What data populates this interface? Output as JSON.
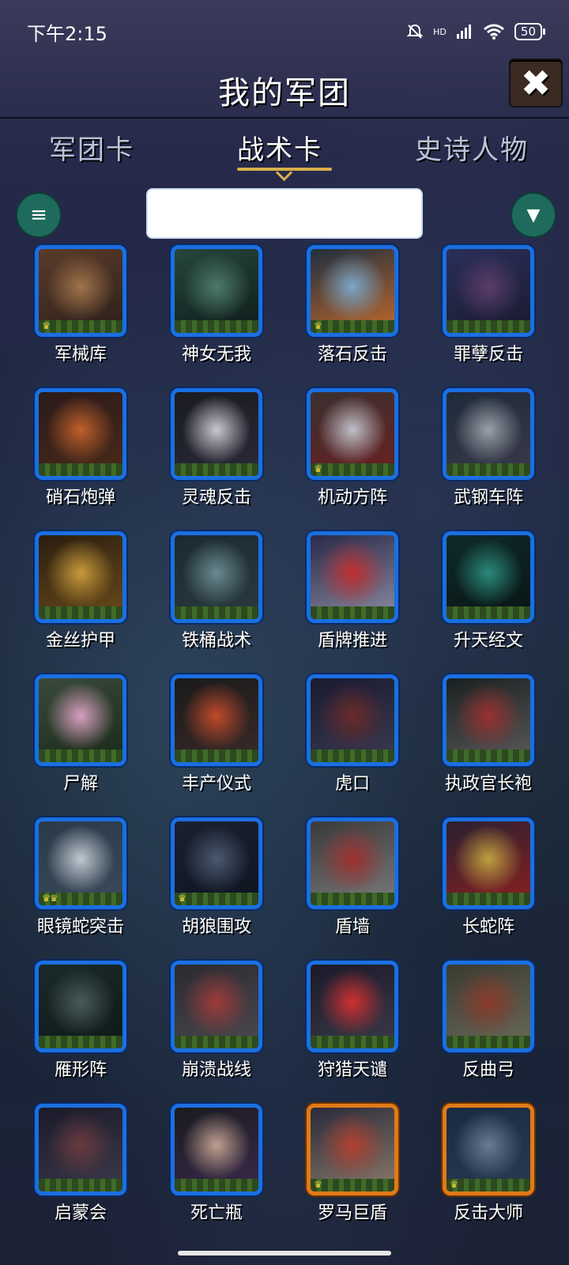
{
  "status_bar": {
    "time": "下午2:15",
    "icons": [
      "bell-off-icon",
      "signal-icon",
      "wifi-icon"
    ],
    "hd_label": "HD",
    "battery": "50"
  },
  "header": {
    "title": "我的军团",
    "close_label": "✖"
  },
  "tabs": [
    {
      "label": "军团卡",
      "active": false
    },
    {
      "label": "战术卡",
      "active": true
    },
    {
      "label": "史诗人物",
      "active": false
    }
  ],
  "toolbar": {
    "list_icon": "≡",
    "filter_icon": "▼",
    "search_value": ""
  },
  "cards": [
    {
      "name": "军械库",
      "crowns": 1,
      "rarity": "blue",
      "art": [
        "#5a3b2a",
        "#a0744c",
        "#2c1f1a"
      ]
    },
    {
      "name": "神女无我",
      "crowns": 0,
      "rarity": "blue",
      "art": [
        "#26463c",
        "#4e7a6a",
        "#0f1c1a"
      ]
    },
    {
      "name": "落石反击",
      "crowns": 1,
      "rarity": "blue",
      "art": [
        "#1f2f40",
        "#7aa6c8",
        "#c0682a"
      ]
    },
    {
      "name": "罪孽反击",
      "crowns": 0,
      "rarity": "blue",
      "art": [
        "#2a2f5a",
        "#5a3c6a",
        "#1a1a2e"
      ]
    },
    {
      "name": "硝石炮弹",
      "crowns": 0,
      "rarity": "blue",
      "art": [
        "#2a1a1a",
        "#c0602a",
        "#4a2a1a"
      ]
    },
    {
      "name": "灵魂反击",
      "crowns": 0,
      "rarity": "blue",
      "art": [
        "#1a1a20",
        "#c8c8d0",
        "#2a2a3a"
      ]
    },
    {
      "name": "机动方阵",
      "crowns": 1,
      "rarity": "blue",
      "art": [
        "#3a3030",
        "#c0c0c8",
        "#6a2020"
      ]
    },
    {
      "name": "武钢车阵",
      "crowns": 0,
      "rarity": "blue",
      "art": [
        "#1e2a3a",
        "#9aa0a8",
        "#3a3a4a"
      ]
    },
    {
      "name": "金丝护甲",
      "crowns": 0,
      "rarity": "blue",
      "art": [
        "#2a1e10",
        "#c89a3a",
        "#6a4a1a"
      ]
    },
    {
      "name": "铁桶战术",
      "crowns": 0,
      "rarity": "blue",
      "art": [
        "#1a2a30",
        "#6a8a90",
        "#2a3a40"
      ]
    },
    {
      "name": "盾牌推进",
      "crowns": 0,
      "rarity": "blue",
      "art": [
        "#2a2a4a",
        "#c03030",
        "#8a8aa0"
      ]
    },
    {
      "name": "升天经文",
      "crowns": 0,
      "rarity": "blue",
      "art": [
        "#0e2a2a",
        "#2a8a7a",
        "#0a1414"
      ]
    },
    {
      "name": "尸解",
      "crowns": 0,
      "rarity": "blue",
      "art": [
        "#3a4a3a",
        "#d8a0c0",
        "#1a2a1a"
      ]
    },
    {
      "name": "丰产仪式",
      "crowns": 0,
      "rarity": "blue",
      "art": [
        "#1a1a1a",
        "#c04a2a",
        "#3a2a2a"
      ]
    },
    {
      "name": "虎口",
      "crowns": 0,
      "rarity": "blue",
      "art": [
        "#1a1a30",
        "#6a2a2a",
        "#3a3a50"
      ]
    },
    {
      "name": "执政官长袍",
      "crowns": 0,
      "rarity": "blue",
      "art": [
        "#1a2020",
        "#9a3030",
        "#5a5a5a"
      ]
    },
    {
      "name": "眼镜蛇突击",
      "crowns": 2,
      "rarity": "blue",
      "art": [
        "#2a3a4a",
        "#c0c8d0",
        "#3a4a5a"
      ]
    },
    {
      "name": "胡狼围攻",
      "crowns": 1,
      "rarity": "blue",
      "art": [
        "#1a2030",
        "#4a5a70",
        "#0f1420"
      ]
    },
    {
      "name": "盾墙",
      "crowns": 0,
      "rarity": "blue",
      "art": [
        "#3a3a3a",
        "#a03030",
        "#7a7a7a"
      ]
    },
    {
      "name": "长蛇阵",
      "crowns": 0,
      "rarity": "blue",
      "art": [
        "#2a2030",
        "#c0a040",
        "#8a2020"
      ]
    },
    {
      "name": "雁形阵",
      "crowns": 0,
      "rarity": "blue",
      "art": [
        "#1a2a2a",
        "#4a5a5a",
        "#0f1818"
      ]
    },
    {
      "name": "崩溃战线",
      "crowns": 0,
      "rarity": "blue",
      "art": [
        "#2a2a30",
        "#a03a3a",
        "#4a4a50"
      ]
    },
    {
      "name": "狩猎天谴",
      "crowns": 0,
      "rarity": "blue",
      "art": [
        "#1a1a2a",
        "#d03030",
        "#3a3a4a"
      ]
    },
    {
      "name": "反曲弓",
      "crowns": 0,
      "rarity": "blue",
      "art": [
        "#3a3a30",
        "#8a3a2a",
        "#6a6a5a"
      ]
    },
    {
      "name": "启蒙会",
      "crowns": 0,
      "rarity": "blue",
      "art": [
        "#1a1a2a",
        "#6a3a40",
        "#3a3a4a"
      ]
    },
    {
      "name": "死亡瓶",
      "crowns": 0,
      "rarity": "blue",
      "art": [
        "#1a1a20",
        "#c0a090",
        "#3a2a4a"
      ]
    },
    {
      "name": "罗马巨盾",
      "crowns": 1,
      "rarity": "gold",
      "art": [
        "#2a2a3a",
        "#b04030",
        "#8a7a6a"
      ]
    },
    {
      "name": "反击大师",
      "crowns": 1,
      "rarity": "gold",
      "art": [
        "#1a2a40",
        "#6a7a90",
        "#2a3a50"
      ]
    }
  ]
}
